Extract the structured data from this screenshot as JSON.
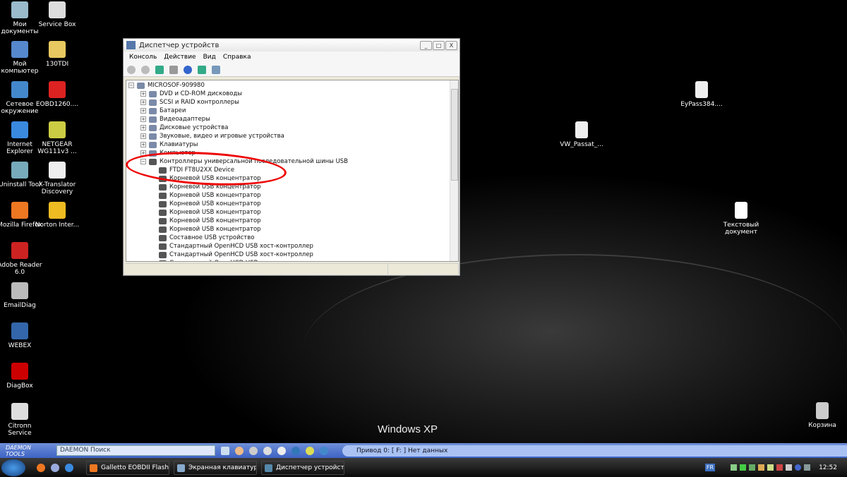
{
  "desktop": {
    "left_icons": [
      {
        "label": "Мои документы",
        "color": "#9bc"
      },
      {
        "label": "Service Box",
        "color": "#ddd"
      },
      {
        "label": "Мой компьютер",
        "color": "#58c"
      },
      {
        "label": "130TDI",
        "color": "#e8c860"
      },
      {
        "label": "Сетевое окружение",
        "color": "#48c"
      },
      {
        "label": "EOBD1260....",
        "color": "#d22"
      },
      {
        "label": "Internet Explorer",
        "color": "#3a8ae0"
      },
      {
        "label": "NETGEAR WG111v3 ...",
        "color": "#cc4"
      },
      {
        "label": "Uninstall Tool",
        "color": "#7ab"
      },
      {
        "label": "X-Translator Discovery",
        "color": "#eee"
      },
      {
        "label": "Mozilla Firefox",
        "color": "#e72"
      },
      {
        "label": "Norton Inter...",
        "color": "#eb2"
      },
      {
        "label": "Adobe Reader 6.0",
        "color": "#c22"
      },
      {
        "label": "EmailDiag",
        "color": "#bbb"
      },
      {
        "label": "WEBEX",
        "color": "#36a"
      },
      {
        "label": "DiagBox",
        "color": "#c00"
      },
      {
        "label": "Citroпn Service",
        "color": "#ddd"
      }
    ],
    "right_icons": [
      {
        "label": "EyPass384....",
        "color": "#eee"
      },
      {
        "label": "VW_Passat_...",
        "color": "#eee"
      },
      {
        "label": "Текстовый документ",
        "color": "#fff"
      },
      {
        "label": "Корзина",
        "color": "#ccc"
      }
    ],
    "os_brand": "Windows XP"
  },
  "window": {
    "title": "Диспетчер устройств",
    "controls": [
      "_",
      "□",
      "X"
    ],
    "menu": [
      "Консоль",
      "Действие",
      "Вид",
      "Справка"
    ],
    "tree": {
      "root": "MICROSOF-909980",
      "categories": [
        "DVD и CD-ROM дисководы",
        "SCSI и RAID контроллеры",
        "Батареи",
        "Видеоадаптеры",
        "Дисковые устройства",
        "Звуковые, видео и игровые устройства",
        "Клавиатуры",
        "Компьютер",
        "Контроллеры универсальной последовательной шины USB"
      ],
      "usb_children": [
        "FTDI FT8U2XX Device",
        "Корневой USB концентратор",
        "Корневой USB концентратор",
        "Корневой USB концентратор",
        "Корневой USB концентратор",
        "Корневой USB концентратор",
        "Корневой USB концентратор",
        "Корневой USB концентратор",
        "Составное USB устройство",
        "Стандартный OpenHCD USB хост-контроллер",
        "Стандартный OpenHCD USB хост-контроллер",
        "Стандартный OpenHCD USB хост-контроллер"
      ]
    }
  },
  "daemon": {
    "logo": "DAEMON TOOLS",
    "search_placeholder": "DAEMON Поиск",
    "drive": "Привод 0: [ F: ] Нет данных"
  },
  "taskbar": {
    "buttons": [
      {
        "label": "Galletto EOBDII Flash...",
        "color": "#e72"
      },
      {
        "label": "Экранная клавиатура",
        "color": "#8ac"
      },
      {
        "label": "Диспетчер устройств",
        "color": "#58a"
      }
    ],
    "lang": "FR",
    "clock": "12:52"
  }
}
